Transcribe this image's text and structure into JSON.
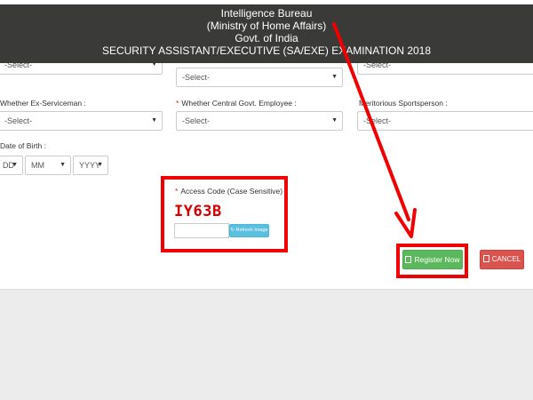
{
  "header": {
    "line1": "Intelligence Bureau",
    "line2": "(Ministry of Home Affairs)",
    "line3": "Govt. of India",
    "line4": "SECURITY ASSISTANT/EXECUTIVE (SA/EXE) EXAMINATION 2018"
  },
  "row1": {
    "left_value": "-Select-",
    "mid_value": "-Select-",
    "right_value": "-Select-"
  },
  "row2": {
    "ex_serviceman_label": "Whether Ex-Serviceman :",
    "ex_serviceman_value": "-Select-",
    "central_govt_label": "Whether Central Govt. Employee :",
    "central_govt_value": "-Select-",
    "sportsperson_label": "Meritorious Sportsperson :",
    "sportsperson_value": "-Select-"
  },
  "dob": {
    "label": "Date of Birth :",
    "day": "DD",
    "month": "MM",
    "year": "YYYY"
  },
  "access_code": {
    "required_mark": "*",
    "label": "Access Code (Case Sensitive) :",
    "captcha": "IY63B",
    "input_value": "",
    "refresh_label": "Refresh Image"
  },
  "buttons": {
    "register_label": "Register Now",
    "cancel_label": "CANCEL"
  },
  "colors": {
    "annotation": "#f00000",
    "register": "#5cb85c",
    "cancel": "#d9534f",
    "refresh": "#5bc0de",
    "header_bg": "#3a3a38"
  }
}
